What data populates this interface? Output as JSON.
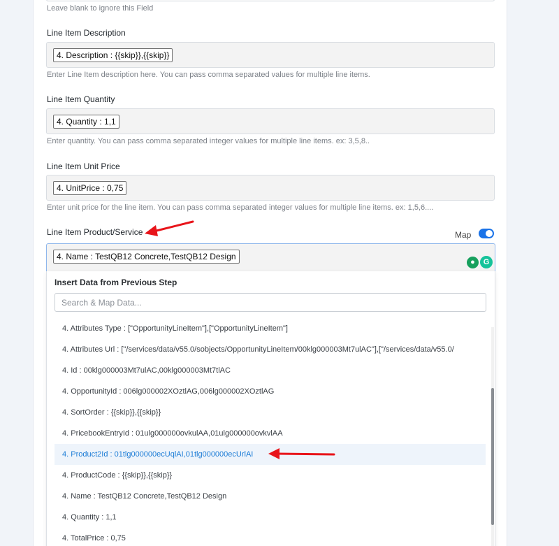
{
  "top_hint": "Leave blank to ignore this Field",
  "fields": [
    {
      "label": "Line Item Description",
      "value": "4. Description : {{skip}},{{skip}}",
      "hint": "Enter Line Item description here. You can pass comma separated values for multiple line items."
    },
    {
      "label": "Line Item Quantity",
      "value": "4. Quantity : 1,1",
      "hint": "Enter quantity. You can pass comma separated integer values for multiple line items. ex: 3,5,8.."
    },
    {
      "label": "Line Item Unit Price",
      "value": "4. UnitPrice : 0,75",
      "hint": "Enter unit price for the line item. You can pass comma separated integer values for multiple line items. ex: 1,5,6...."
    }
  ],
  "product_field": {
    "label": "Line Item Product/Service",
    "map_label": "Map",
    "map_enabled": true,
    "value": "4. Name : TestQB12 Concrete,TestQB12 Design"
  },
  "dropdown": {
    "title": "Insert Data from Previous Step",
    "search_placeholder": "Search & Map Data...",
    "items": [
      "4. Attributes Type : [\"OpportunityLineItem\"],[\"OpportunityLineItem\"]",
      "4. Attributes Url : [\"/services/data/v55.0/sobjects/OpportunityLineItem/00klg000003Mt7ulAC\"],[\"/services/data/v55.0/",
      "4. Id : 00klg000003Mt7ulAC,00klg000003Mt7tlAC",
      "4. OpportunityId : 006lg000002XOztlAG,006lg000002XOztlAG",
      "4. SortOrder : {{skip}},{{skip}}",
      "4. PricebookEntryId : 01ulg000000ovkulAA,01ulg000000ovkvlAA",
      "4. Product2Id : 01tlg000000ecUqlAI,01tlg000000ecUrlAI",
      "4. ProductCode : {{skip}},{{skip}}",
      "4. Name : TestQB12 Concrete,TestQB12 Design",
      "4. Quantity : 1,1",
      "4. TotalPrice : 0,75"
    ],
    "highlighted_index": 6
  },
  "colors": {
    "accent": "#1a73e8",
    "highlight_text": "#1c7cd6",
    "arrow": "#e8141a"
  }
}
